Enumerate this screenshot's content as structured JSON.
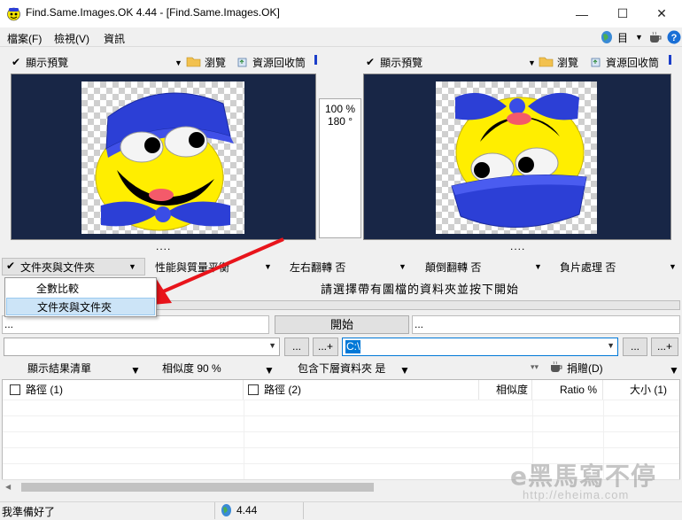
{
  "window": {
    "title": "Find.Same.Images.OK 4.44 - [Find.Same.Images.OK]",
    "minimize": "—",
    "maximize": "☐",
    "close": "✕"
  },
  "menu": {
    "items": [
      "檔案(F)",
      "檢視(V)",
      "資訊"
    ],
    "right_label": "目"
  },
  "preview_left": {
    "show_preview": "顯示預覽",
    "browse": "瀏覽",
    "recycle": "資源回收筒",
    "checkmark": "✔"
  },
  "preview_right": {
    "show_preview": "顯示預覽",
    "browse": "瀏覽",
    "recycle": "資源回收筒",
    "checkmark": "✔"
  },
  "ratio": {
    "similarity": "100 %",
    "angle": "180 °"
  },
  "dots_left": "....",
  "dots_right": "....",
  "options": {
    "compare_mode": "文件夾與文件夾",
    "performance": "性能與質量平衡",
    "flip_lr": "左右翻轉 否",
    "flip_ud": "顛倒翻轉 否",
    "negative": "負片處理 否"
  },
  "dropdown": {
    "items": [
      "全數比較",
      "文件夾與文件夾"
    ],
    "selected_index": 1
  },
  "status_message": "請選擇帶有圖檔的資料夾並按下開始",
  "start": {
    "label": "開始",
    "left_field": "...",
    "right_field": "..."
  },
  "paths": {
    "left_value": "",
    "right_value": "C:\\",
    "btn_browse": "...",
    "btn_add": "...+"
  },
  "result_options": {
    "list": "顯示結果清單",
    "similarity": "相似度 90 %",
    "subfolders": "包含下層資料夾 是",
    "donate": "捐贈(D)"
  },
  "table": {
    "columns": [
      "路徑 (1)",
      "路徑 (2)",
      "相似度",
      "Ratio %",
      "大小 (1)"
    ]
  },
  "statusbar": {
    "message": "我準備好了",
    "version": "4.44"
  },
  "watermark": {
    "brand": "e黑馬寫不停",
    "url": "http://eheima.com"
  },
  "colors": {
    "preview_bg": "#182646",
    "accent": "#0078d7",
    "arrow": "#e8141b",
    "smiley": "#ffee00",
    "hat": "#2c3fd6"
  }
}
